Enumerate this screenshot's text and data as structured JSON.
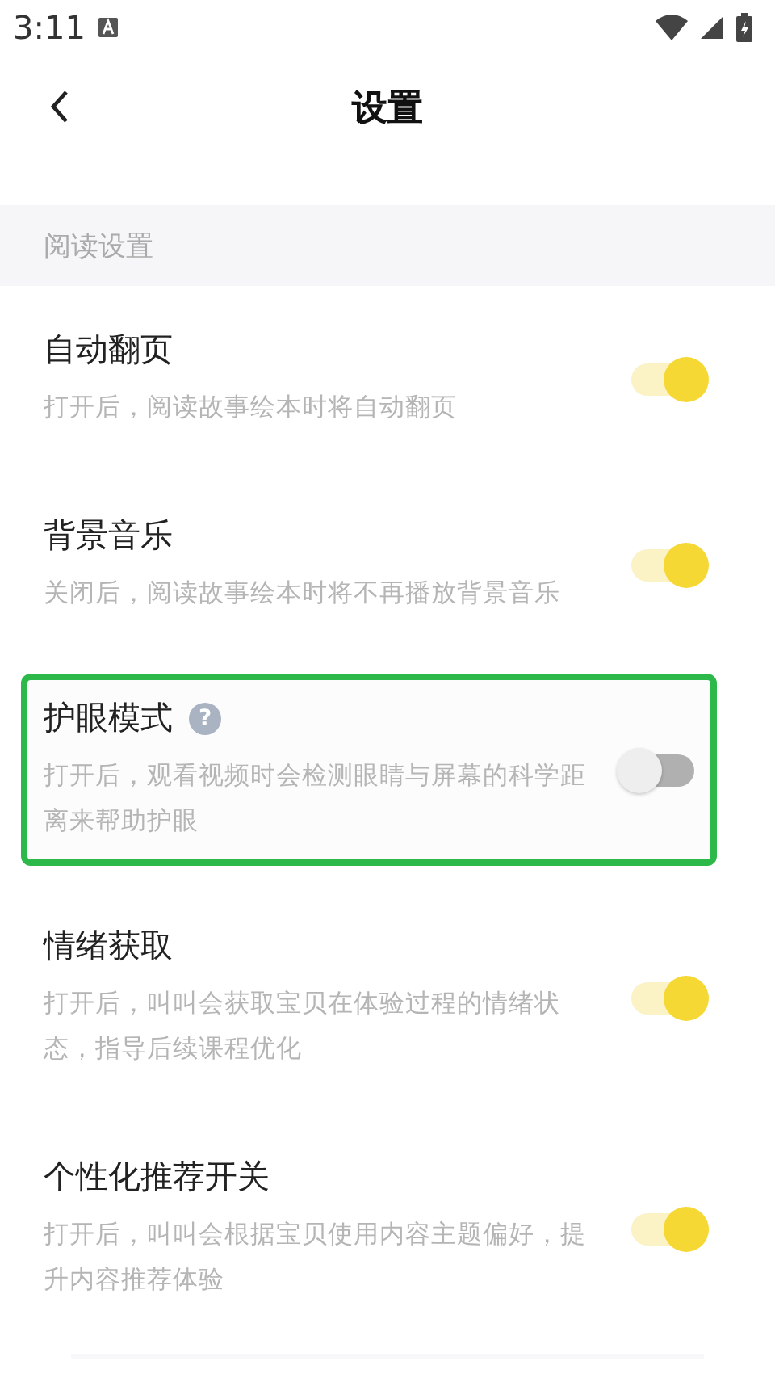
{
  "status_bar": {
    "time": "3:11"
  },
  "header": {
    "title": "设置"
  },
  "section": {
    "title": "阅读设置"
  },
  "settings": [
    {
      "title": "自动翻页",
      "description": "打开后，阅读故事绘本时将自动翻页",
      "on": true,
      "highlighted": false
    },
    {
      "title": "背景音乐",
      "description": "关闭后，阅读故事绘本时将不再播放背景音乐",
      "on": true,
      "highlighted": false
    },
    {
      "title": "护眼模式",
      "description": "打开后，观看视频时会检测眼睛与屏幕的科学距离来帮助护眼",
      "on": false,
      "help_icon": "?",
      "highlighted": true
    },
    {
      "title": "情绪获取",
      "description": "打开后，叫叫会获取宝贝在体验过程的情绪状态，指导后续课程优化",
      "on": true,
      "highlighted": false
    },
    {
      "title": "个性化推荐开关",
      "description": "打开后，叫叫会根据宝贝使用内容主题偏好，提升内容推荐体验",
      "on": true,
      "highlighted": false
    }
  ]
}
